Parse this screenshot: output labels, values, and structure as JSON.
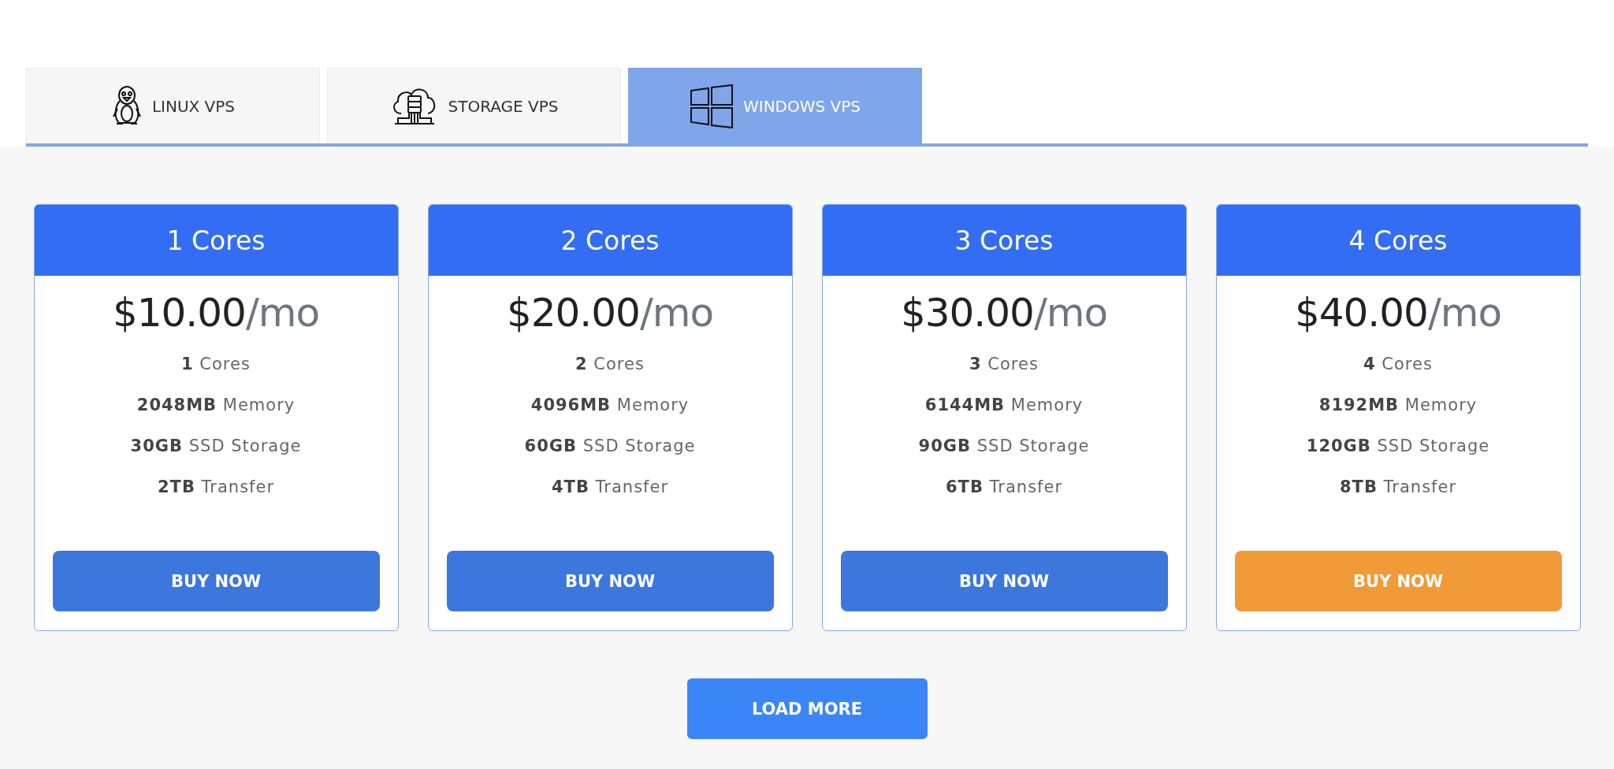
{
  "tabs": [
    {
      "label": "LINUX VPS",
      "selected": false
    },
    {
      "label": "STORAGE VPS",
      "selected": false
    },
    {
      "label": "WINDOWS VPS",
      "selected": true
    }
  ],
  "plans": [
    {
      "title": "1 Cores",
      "price": "$10.00",
      "period": "/mo",
      "features": [
        "**1** Cores",
        "**2048MB** Memory",
        "**30GB** SSD Storage",
        "**2TB** Transfer"
      ],
      "button": "BUY NOW",
      "highlighted": false
    },
    {
      "title": "2 Cores",
      "price": "$20.00",
      "period": "/mo",
      "features": [
        "**2** Cores",
        "**4096MB** Memory",
        "**60GB** SSD Storage",
        "**4TB** Transfer"
      ],
      "button": "BUY NOW",
      "highlighted": false
    },
    {
      "title": "3 Cores",
      "price": "$30.00",
      "period": "/mo",
      "features": [
        "**3** Cores",
        "**6144MB** Memory",
        "**90GB** SSD Storage",
        "**6TB** Transfer"
      ],
      "button": "BUY NOW",
      "highlighted": false
    },
    {
      "title": "4 Cores",
      "price": "$40.00",
      "period": "/mo",
      "features": [
        "**4** Cores",
        "**8192MB** Memory",
        "**120GB** SSD Storage",
        "**8TB** Transfer"
      ],
      "button": "BUY NOW",
      "highlighted": true
    }
  ],
  "load_more": "LOAD MORE"
}
